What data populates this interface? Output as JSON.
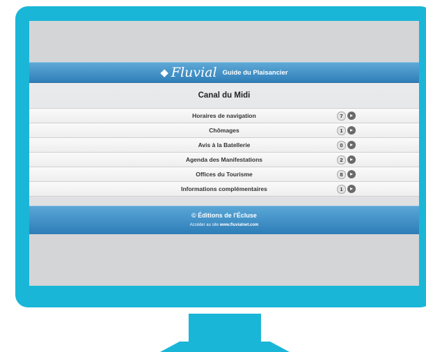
{
  "header": {
    "logo_text": "Fluvial",
    "subtitle": "Guide du Plaisancier"
  },
  "section": {
    "title": "Canal du Midi"
  },
  "menu": [
    {
      "label": "Horaires de navigation",
      "count": "7"
    },
    {
      "label": "Chômages",
      "count": "1"
    },
    {
      "label": "Avis à la Batellerie",
      "count": "0"
    },
    {
      "label": "Agenda des Manifestations",
      "count": "2"
    },
    {
      "label": "Offices du Tourisme",
      "count": "8"
    },
    {
      "label": "Informations complémentaires",
      "count": "1"
    }
  ],
  "footer": {
    "copyright": "© Éditions de l'Écluse",
    "link_prefix": "Accéder au site",
    "link_url": "www.fluvialnet.com"
  },
  "colors": {
    "monitor": "#1ab6d8",
    "header_bar": "#3f8fc6",
    "screen_bg": "#d4d5d7"
  }
}
